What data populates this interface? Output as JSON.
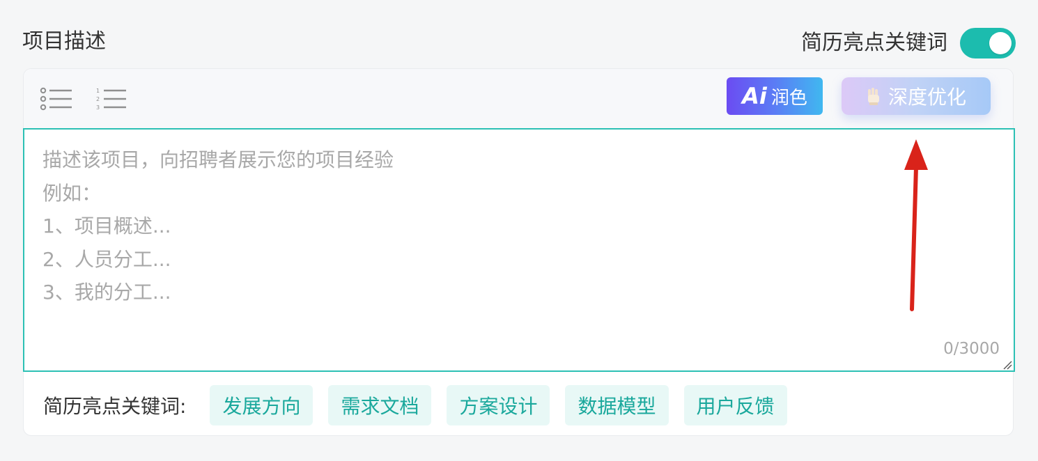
{
  "section": {
    "title": "项目描述"
  },
  "keywords_toggle": {
    "label": "简历亮点关键词",
    "enabled": true,
    "color": "#1cbcae"
  },
  "toolbar": {
    "bullet_list_icon": "bullet-list-icon",
    "numbered_list_icon": "numbered-list-icon",
    "ai_polish": {
      "logo": "Ai",
      "label": "润色"
    },
    "deep_optimize": {
      "label": "深度优化",
      "icon": "hand-icon"
    }
  },
  "editor": {
    "placeholder_lines": [
      "描述该项目，向招聘者展示您的项目经验",
      "例如：",
      "1、项目概述...",
      "2、人员分工...",
      "3、我的分工..."
    ],
    "counter": "0/3000",
    "border_color": "#2cc0b4"
  },
  "keywords_row": {
    "label": "简历亮点关键词:",
    "chips": [
      "发展方向",
      "需求文档",
      "方案设计",
      "数据模型",
      "用户反馈"
    ]
  },
  "annotation": {
    "arrow_color": "#d9231a",
    "arrow_icon": "arrow-up-icon"
  }
}
